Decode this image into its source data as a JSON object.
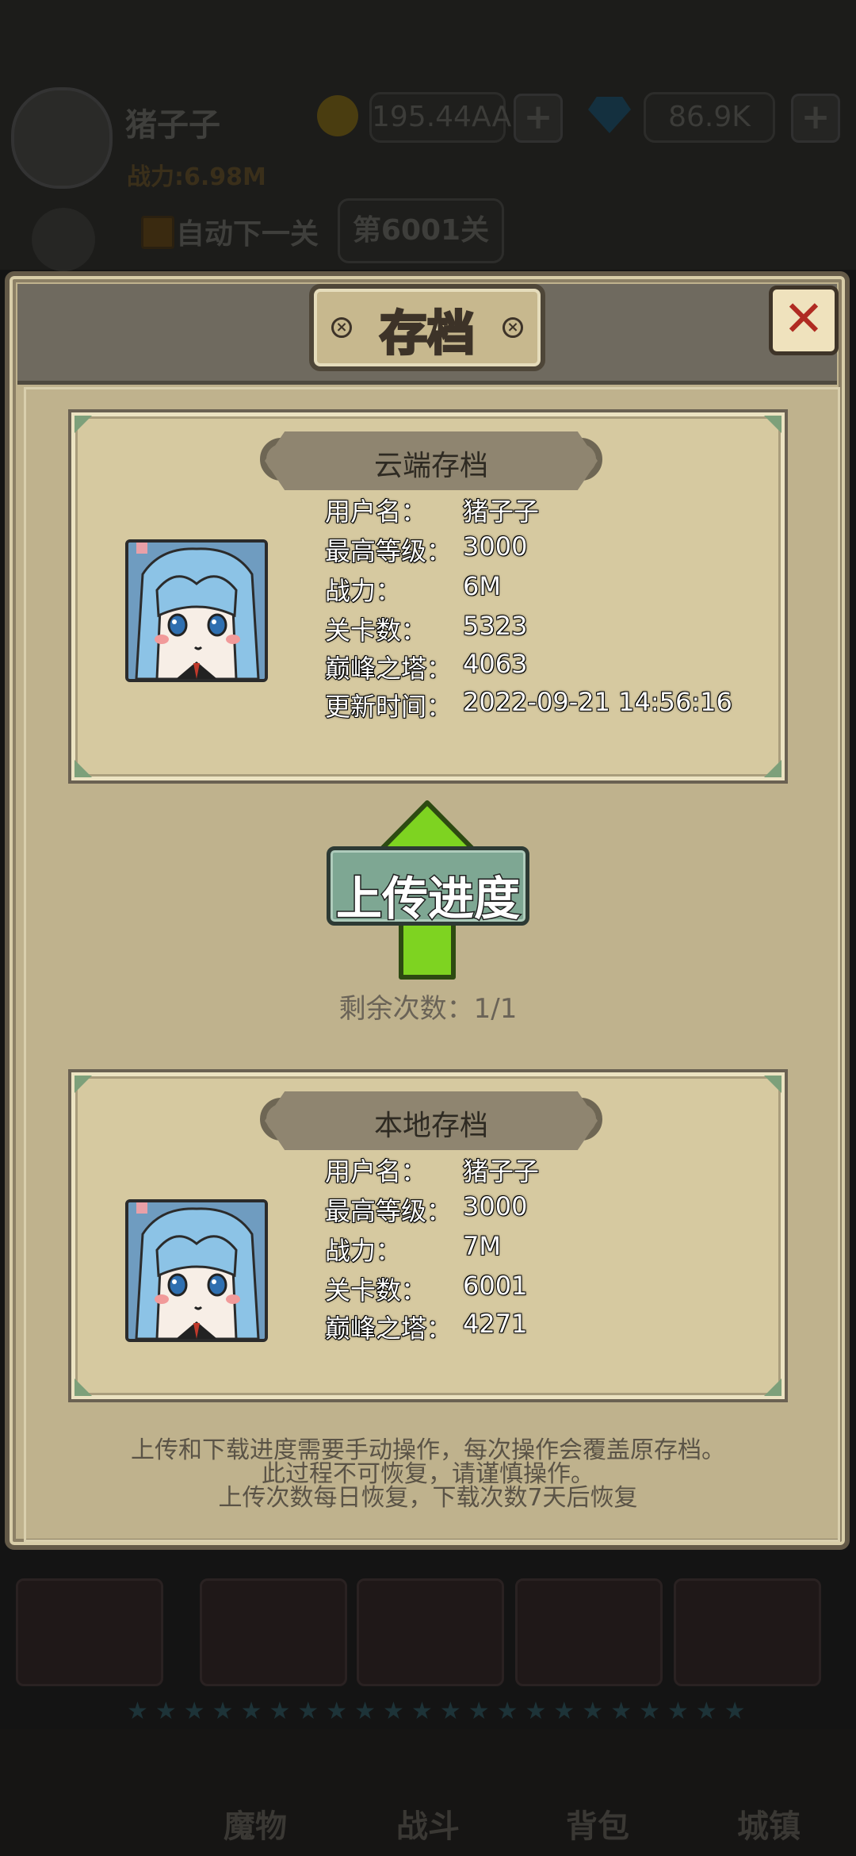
{
  "background": {
    "player_name": "猪子子",
    "gold": "195.44AA",
    "gems": "86.9K",
    "power_label": "战力:6.98M",
    "auto_next_label": "自动下一关",
    "level_label": "第6001关",
    "nav": [
      "魔物",
      "战斗",
      "背包",
      "城镇"
    ]
  },
  "dialog": {
    "title": "存档",
    "close_label": "✕"
  },
  "cloud_save": {
    "header": "云端存档",
    "rows": [
      {
        "label": "用户名：",
        "value": "猪子子"
      },
      {
        "label": "最高等级：",
        "value": "3000"
      },
      {
        "label": "战力：",
        "value": "6M"
      },
      {
        "label": "关卡数：",
        "value": "5323"
      },
      {
        "label": "巅峰之塔：",
        "value": "4063"
      },
      {
        "label": "更新时间：",
        "value": "2022-09-21 14:56:16"
      }
    ]
  },
  "upload": {
    "label": "上传进度",
    "remaining": "剩余次数：1/1"
  },
  "local_save": {
    "header": "本地存档",
    "rows": [
      {
        "label": "用户名：",
        "value": "猪子子"
      },
      {
        "label": "最高等级：",
        "value": "3000"
      },
      {
        "label": "战力：",
        "value": "7M"
      },
      {
        "label": "关卡数：",
        "value": "6001"
      },
      {
        "label": "巅峰之塔：",
        "value": "4271"
      }
    ]
  },
  "notes": [
    "上传和下载进度需要手动操作，每次操作会覆盖原存档。",
    "此过程不可恢复，请谨慎操作。",
    "上传次数每日恢复，下载次数7天后恢复"
  ],
  "colors": {
    "dialog_bg": "#bfb28d",
    "upload_arrow": "#7ed321",
    "close_x": "#b02b22"
  }
}
